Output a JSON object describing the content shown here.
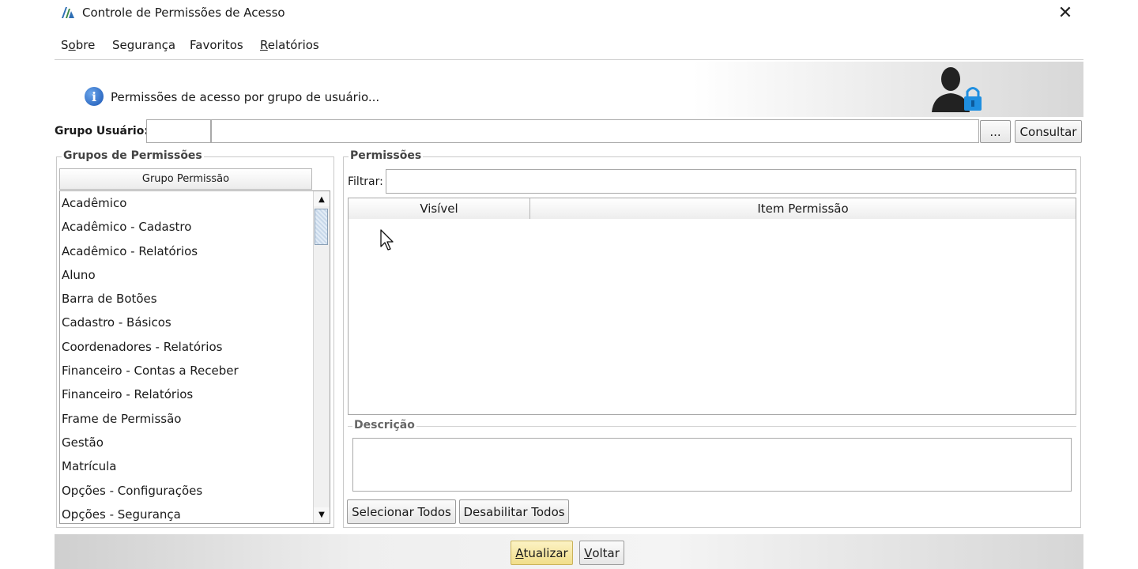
{
  "window": {
    "title": "Controle de Permissões de Acesso",
    "close_glyph": "✕",
    "logo_icon": "app-logo-icon"
  },
  "menu": [
    {
      "pre": "S",
      "ul": "o",
      "post": "bre"
    },
    {
      "pre": "",
      "ul": "",
      "post": "Segurança"
    },
    {
      "pre": "",
      "ul": "",
      "post": "Favoritos"
    },
    {
      "pre": "",
      "ul": "R",
      "post": "elatórios"
    }
  ],
  "banner": {
    "text": "Permissões de acesso por grupo de usuário...",
    "info_glyph": "i",
    "user_icon": "user-lock-icon"
  },
  "grupo": {
    "label": "Grupo Usuário:",
    "code_value": "",
    "name_value": "",
    "browse_label": "...",
    "consultar_label": "Consultar"
  },
  "grupos_permissoes": {
    "title": "Grupos de Permissões",
    "column_header": "Grupo Permissão",
    "items": [
      "Acadêmico",
      "Acadêmico - Cadastro",
      "Acadêmico - Relatórios",
      "Aluno",
      "Barra de Botões",
      "Cadastro - Básicos",
      "Coordenadores - Relatórios",
      "Financeiro - Contas a Receber",
      "Financeiro - Relatórios",
      "Frame de Permissão",
      "Gestão",
      "Matrícula",
      "Opções - Configurações",
      "Opções - Segurança"
    ],
    "scroll_up": "▲",
    "scroll_down": "▼"
  },
  "permissoes": {
    "title": "Permissões",
    "filter_label": "Filtrar:",
    "filter_value": "",
    "columns": [
      "Visível",
      "Item Permissão"
    ],
    "rows": [],
    "descricao_title": "Descrição",
    "descricao_value": "",
    "select_all_label": "Selecionar Todos",
    "disable_all_label": "Desabilitar Todos"
  },
  "footer": {
    "atualizar": {
      "ul": "A",
      "post": "tualizar"
    },
    "voltar": {
      "ul": "V",
      "post": "oltar"
    }
  },
  "colors": {
    "accent_button": "#f6e7a6",
    "info_blue": "#1a56b5",
    "lock_blue": "#1f8fe0"
  }
}
